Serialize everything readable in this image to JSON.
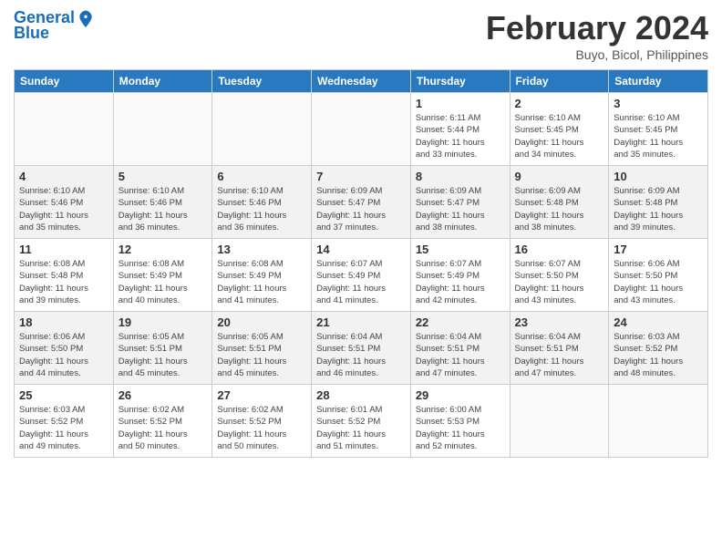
{
  "logo": {
    "line1": "General",
    "line2": "Blue"
  },
  "title": "February 2024",
  "subtitle": "Buyo, Bicol, Philippines",
  "headers": [
    "Sunday",
    "Monday",
    "Tuesday",
    "Wednesday",
    "Thursday",
    "Friday",
    "Saturday"
  ],
  "weeks": [
    [
      {
        "day": "",
        "info": ""
      },
      {
        "day": "",
        "info": ""
      },
      {
        "day": "",
        "info": ""
      },
      {
        "day": "",
        "info": ""
      },
      {
        "day": "1",
        "info": "Sunrise: 6:11 AM\nSunset: 5:44 PM\nDaylight: 11 hours\nand 33 minutes."
      },
      {
        "day": "2",
        "info": "Sunrise: 6:10 AM\nSunset: 5:45 PM\nDaylight: 11 hours\nand 34 minutes."
      },
      {
        "day": "3",
        "info": "Sunrise: 6:10 AM\nSunset: 5:45 PM\nDaylight: 11 hours\nand 35 minutes."
      }
    ],
    [
      {
        "day": "4",
        "info": "Sunrise: 6:10 AM\nSunset: 5:46 PM\nDaylight: 11 hours\nand 35 minutes."
      },
      {
        "day": "5",
        "info": "Sunrise: 6:10 AM\nSunset: 5:46 PM\nDaylight: 11 hours\nand 36 minutes."
      },
      {
        "day": "6",
        "info": "Sunrise: 6:10 AM\nSunset: 5:46 PM\nDaylight: 11 hours\nand 36 minutes."
      },
      {
        "day": "7",
        "info": "Sunrise: 6:09 AM\nSunset: 5:47 PM\nDaylight: 11 hours\nand 37 minutes."
      },
      {
        "day": "8",
        "info": "Sunrise: 6:09 AM\nSunset: 5:47 PM\nDaylight: 11 hours\nand 38 minutes."
      },
      {
        "day": "9",
        "info": "Sunrise: 6:09 AM\nSunset: 5:48 PM\nDaylight: 11 hours\nand 38 minutes."
      },
      {
        "day": "10",
        "info": "Sunrise: 6:09 AM\nSunset: 5:48 PM\nDaylight: 11 hours\nand 39 minutes."
      }
    ],
    [
      {
        "day": "11",
        "info": "Sunrise: 6:08 AM\nSunset: 5:48 PM\nDaylight: 11 hours\nand 39 minutes."
      },
      {
        "day": "12",
        "info": "Sunrise: 6:08 AM\nSunset: 5:49 PM\nDaylight: 11 hours\nand 40 minutes."
      },
      {
        "day": "13",
        "info": "Sunrise: 6:08 AM\nSunset: 5:49 PM\nDaylight: 11 hours\nand 41 minutes."
      },
      {
        "day": "14",
        "info": "Sunrise: 6:07 AM\nSunset: 5:49 PM\nDaylight: 11 hours\nand 41 minutes."
      },
      {
        "day": "15",
        "info": "Sunrise: 6:07 AM\nSunset: 5:49 PM\nDaylight: 11 hours\nand 42 minutes."
      },
      {
        "day": "16",
        "info": "Sunrise: 6:07 AM\nSunset: 5:50 PM\nDaylight: 11 hours\nand 43 minutes."
      },
      {
        "day": "17",
        "info": "Sunrise: 6:06 AM\nSunset: 5:50 PM\nDaylight: 11 hours\nand 43 minutes."
      }
    ],
    [
      {
        "day": "18",
        "info": "Sunrise: 6:06 AM\nSunset: 5:50 PM\nDaylight: 11 hours\nand 44 minutes."
      },
      {
        "day": "19",
        "info": "Sunrise: 6:05 AM\nSunset: 5:51 PM\nDaylight: 11 hours\nand 45 minutes."
      },
      {
        "day": "20",
        "info": "Sunrise: 6:05 AM\nSunset: 5:51 PM\nDaylight: 11 hours\nand 45 minutes."
      },
      {
        "day": "21",
        "info": "Sunrise: 6:04 AM\nSunset: 5:51 PM\nDaylight: 11 hours\nand 46 minutes."
      },
      {
        "day": "22",
        "info": "Sunrise: 6:04 AM\nSunset: 5:51 PM\nDaylight: 11 hours\nand 47 minutes."
      },
      {
        "day": "23",
        "info": "Sunrise: 6:04 AM\nSunset: 5:51 PM\nDaylight: 11 hours\nand 47 minutes."
      },
      {
        "day": "24",
        "info": "Sunrise: 6:03 AM\nSunset: 5:52 PM\nDaylight: 11 hours\nand 48 minutes."
      }
    ],
    [
      {
        "day": "25",
        "info": "Sunrise: 6:03 AM\nSunset: 5:52 PM\nDaylight: 11 hours\nand 49 minutes."
      },
      {
        "day": "26",
        "info": "Sunrise: 6:02 AM\nSunset: 5:52 PM\nDaylight: 11 hours\nand 50 minutes."
      },
      {
        "day": "27",
        "info": "Sunrise: 6:02 AM\nSunset: 5:52 PM\nDaylight: 11 hours\nand 50 minutes."
      },
      {
        "day": "28",
        "info": "Sunrise: 6:01 AM\nSunset: 5:52 PM\nDaylight: 11 hours\nand 51 minutes."
      },
      {
        "day": "29",
        "info": "Sunrise: 6:00 AM\nSunset: 5:53 PM\nDaylight: 11 hours\nand 52 minutes."
      },
      {
        "day": "",
        "info": ""
      },
      {
        "day": "",
        "info": ""
      }
    ]
  ]
}
